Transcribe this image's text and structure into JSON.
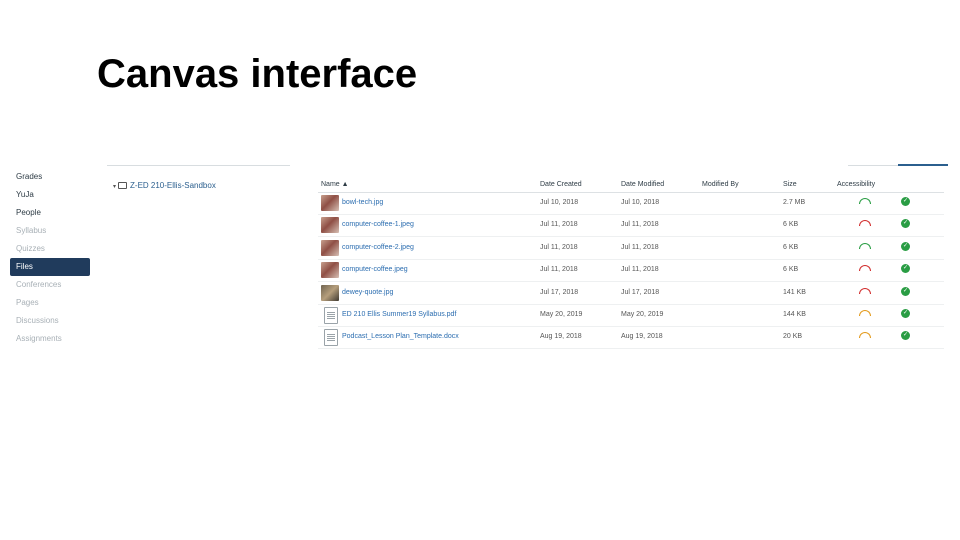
{
  "slide": {
    "title": "Canvas interface"
  },
  "nav": [
    {
      "label": "Grades",
      "state": "normal"
    },
    {
      "label": "YuJa",
      "state": "normal"
    },
    {
      "label": "People",
      "state": "normal"
    },
    {
      "label": "Syllabus",
      "state": "muted"
    },
    {
      "label": "Quizzes",
      "state": "muted"
    },
    {
      "label": "Files",
      "state": "active"
    },
    {
      "label": "Conferences",
      "state": "muted"
    },
    {
      "label": "Pages",
      "state": "muted"
    },
    {
      "label": "Discussions",
      "state": "muted"
    },
    {
      "label": "Assignments",
      "state": "muted"
    }
  ],
  "folder": {
    "caret": "▾",
    "name": "Z-ED 210-Ellis-Sandbox"
  },
  "columns": {
    "name": "Name ▲",
    "created": "Date Created",
    "modified": "Date Modified",
    "modified_by": "Modified By",
    "size": "Size",
    "accessibility": "Accessibility"
  },
  "files": [
    {
      "name": "bowl-tech.jpg",
      "created": "Jul 10, 2018",
      "modified": "Jul 10, 2018",
      "size": "2.7 MB",
      "thumb": "photo",
      "gauge_color": "#2a9d44"
    },
    {
      "name": "computer-coffee-1.jpeg",
      "created": "Jul 11, 2018",
      "modified": "Jul 11, 2018",
      "size": "6 KB",
      "thumb": "photo",
      "gauge_color": "#d12e2e"
    },
    {
      "name": "computer-coffee-2.jpeg",
      "created": "Jul 11, 2018",
      "modified": "Jul 11, 2018",
      "size": "6 KB",
      "thumb": "photo",
      "gauge_color": "#2a9d44"
    },
    {
      "name": "computer-coffee.jpeg",
      "created": "Jul 11, 2018",
      "modified": "Jul 11, 2018",
      "size": "6 KB",
      "thumb": "photo",
      "gauge_color": "#d12e2e"
    },
    {
      "name": "dewey-quote.jpg",
      "created": "Jul 17, 2018",
      "modified": "Jul 17, 2018",
      "size": "141 KB",
      "thumb": "photo2",
      "gauge_color": "#d12e2e"
    },
    {
      "name": "ED 210 Ellis Summer19 Syllabus.pdf",
      "created": "May 20, 2019",
      "modified": "May 20, 2019",
      "size": "144 KB",
      "thumb": "doc",
      "gauge_color": "#e39a1c"
    },
    {
      "name": "Podcast_Lesson Plan_Template.docx",
      "created": "Aug 19, 2018",
      "modified": "Aug 19, 2018",
      "size": "20 KB",
      "thumb": "doc",
      "gauge_color": "#e39a1c"
    }
  ],
  "status_check_glyph": "✓"
}
